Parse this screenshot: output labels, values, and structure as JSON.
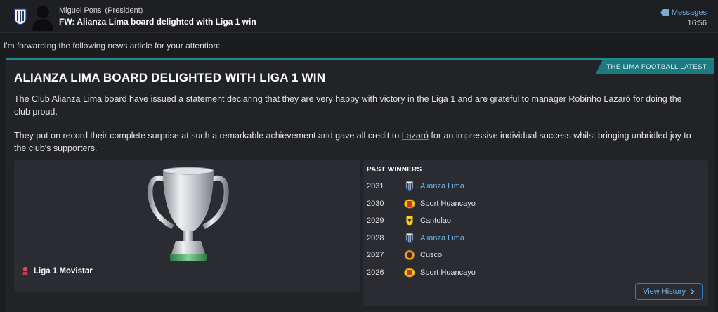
{
  "header": {
    "sender_name": "Miguel Pons",
    "sender_role": "(President)",
    "subject": "FW: Alianza Lima board delighted with Liga 1 win",
    "messages_label": "Messages",
    "time": "16:56"
  },
  "intro": "I'm forwarding the following news article for your attention:",
  "article": {
    "tag": "THE LIMA FOOTBALL LATEST",
    "title": "ALIANZA LIMA BOARD DELIGHTED WITH LIGA 1 WIN",
    "p1_a": "The ",
    "p1_club": "Club Alianza Lima",
    "p1_b": " board have issued a statement declaring that they are very happy with victory in the ",
    "p1_comp": "Liga 1",
    "p1_c": " and are grateful to manager ",
    "p1_manager": "Robinho Lazaró",
    "p1_d": " for doing the club proud.",
    "p2_a": "They put on record their complete surprise at such a remarkable achievement and gave all credit to ",
    "p2_manager": "Lazaró",
    "p2_b": " for an impressive individual success whilst bringing unbridled joy to the club's supporters."
  },
  "competition": {
    "name": "Liga 1 Movistar"
  },
  "past_winners": {
    "title": "PAST WINNERS",
    "rows": [
      {
        "year": "2031",
        "club": "Alianza Lima",
        "icon": "alianza-crest"
      },
      {
        "year": "2030",
        "club": "Sport Huancayo",
        "icon": "huancayo-crest"
      },
      {
        "year": "2029",
        "club": "Cantolao",
        "icon": "cantolao-crest"
      },
      {
        "year": "2028",
        "club": "Alianza Lima",
        "icon": "alianza-crest"
      },
      {
        "year": "2027",
        "club": "Cusco",
        "icon": "cusco-crest"
      },
      {
        "year": "2026",
        "club": "Sport Huancayo",
        "icon": "huancayo-crest"
      }
    ],
    "view_history_label": "View History"
  },
  "colors": {
    "accent_teal": "#1f8a8e",
    "link_blue": "#6fb6e8",
    "background": "#1b1c20",
    "panel": "#2b2c31"
  }
}
